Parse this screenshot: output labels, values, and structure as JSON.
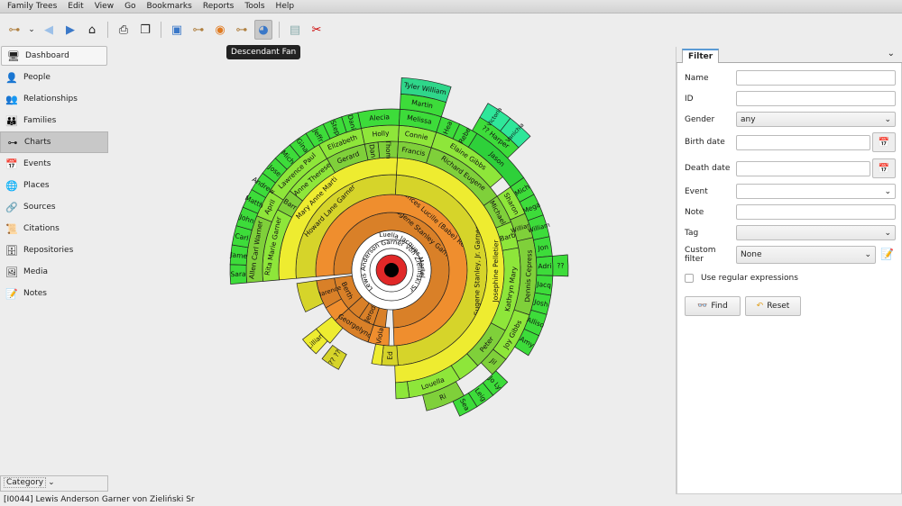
{
  "menu": [
    "Family Trees",
    "Edit",
    "View",
    "Go",
    "Bookmarks",
    "Reports",
    "Tools",
    "Help"
  ],
  "toolbar": {
    "tooltip": "Descendant Fan",
    "icons": [
      "tree-icon",
      "dropdown-icon",
      "back-icon",
      "forward-icon",
      "home-icon",
      "print-icon",
      "copy-icon",
      "config-icon",
      "pedigree-icon",
      "fan-icon",
      "descendant-tree-icon",
      "descendant-fan-icon",
      "media-icon",
      "scissors-icon"
    ]
  },
  "sidebar": {
    "items": [
      {
        "label": "Dashboard",
        "icon": "🖥"
      },
      {
        "label": "People",
        "icon": "👤"
      },
      {
        "label": "Relationships",
        "icon": "👥"
      },
      {
        "label": "Families",
        "icon": "👪"
      },
      {
        "label": "Charts",
        "icon": "⊶"
      },
      {
        "label": "Events",
        "icon": "📅"
      },
      {
        "label": "Places",
        "icon": "🌐"
      },
      {
        "label": "Sources",
        "icon": "🔗"
      },
      {
        "label": "Citations",
        "icon": "📜"
      },
      {
        "label": "Repositories",
        "icon": "🗄"
      },
      {
        "label": "Media",
        "icon": "🖼"
      },
      {
        "label": "Notes",
        "icon": "📝"
      }
    ],
    "selected": "Charts",
    "category": "Category"
  },
  "status": "[I0044] Lewis Anderson Garner von Zieliński Sr",
  "filter": {
    "tab": "Filter",
    "fields": {
      "name": {
        "label": "Name",
        "value": ""
      },
      "id": {
        "label": "ID",
        "value": ""
      },
      "gender": {
        "label": "Gender",
        "value": "any"
      },
      "birth": {
        "label": "Birth date",
        "value": ""
      },
      "death": {
        "label": "Death date",
        "value": ""
      },
      "event": {
        "label": "Event",
        "value": ""
      },
      "note": {
        "label": "Note",
        "value": ""
      },
      "tag": {
        "label": "Tag",
        "value": ""
      },
      "custom": {
        "label": "Custom filter",
        "value": "None"
      }
    },
    "regex": "Use regular expressions",
    "regex_checked": false,
    "find": "Find",
    "reset": "Reset"
  },
  "fan": {
    "center": {
      "person": "Lewis Anderson Garner von Zieliński Sr",
      "spouse": "Luella Jacques Martel",
      "color": "#e02828"
    },
    "segments": [
      {
        "label": "Eugene Stanley Garner",
        "ring": 0,
        "a": [
          -95,
          178
        ],
        "color": "#d98028"
      },
      {
        "label": "Frances Lucille (Babe) Reed",
        "ring": 1,
        "a": [
          -95,
          178
        ],
        "color": "#ef8e2e"
      },
      {
        "label": "Howard Lane Garner",
        "ring": 2,
        "a": [
          -95,
          3
        ],
        "color": "#d6d42a"
      },
      {
        "label": "Eugene Stanley, Jr. Garner",
        "ring": 2,
        "a": [
          3,
          178
        ],
        "color": "#d6d42a"
      },
      {
        "label": "Mary Anne Marti",
        "ring": 3,
        "a": [
          -95,
          3
        ],
        "color": "#eeec30"
      },
      {
        "label": "Josephine Pelletier",
        "ring": 3,
        "a": [
          3,
          178
        ],
        "color": "#eeec30"
      },
      {
        "label": "Rita Marie Garner",
        "ring": 4,
        "a": [
          -95,
          -62
        ],
        "color": "#8ee63a"
      },
      {
        "label": "Barr",
        "ring": 4,
        "a": [
          -62,
          -52
        ],
        "color": "#7fd03a"
      },
      {
        "label": "Anne Therese",
        "ring": 4,
        "a": [
          -52,
          -30
        ],
        "color": "#8ee63a"
      },
      {
        "label": "Gerard",
        "ring": 4,
        "a": [
          -30,
          -12
        ],
        "color": "#7fd03a"
      },
      {
        "label": "Dan",
        "ring": 4,
        "a": [
          -12,
          -6
        ],
        "color": "#7fd03a"
      },
      {
        "label": "Thom",
        "ring": 4,
        "a": [
          -6,
          3
        ],
        "color": "#7fd03a"
      },
      {
        "label": "Francis",
        "ring": 4,
        "a": [
          3,
          18
        ],
        "color": "#7fd03a"
      },
      {
        "label": "Richard Eugene",
        "ring": 4,
        "a": [
          18,
          55
        ],
        "color": "#7fd03a"
      },
      {
        "label": "Michael",
        "ring": 4,
        "a": [
          55,
          68
        ],
        "color": "#7fd03a"
      },
      {
        "label": "Barb",
        "ring": 4,
        "a": [
          68,
          80
        ],
        "color": "#8ee63a"
      },
      {
        "label": "Kathryn Mary",
        "ring": 4,
        "a": [
          80,
          118
        ],
        "color": "#8ee63a"
      },
      {
        "label": "Peter",
        "ring": 4,
        "a": [
          118,
          138
        ],
        "color": "#7fd03a"
      },
      {
        "label": "",
        "ring": 4,
        "a": [
          138,
          148
        ],
        "color": "#8ee63a"
      },
      {
        "label": "Louella",
        "ring": 4,
        "a": [
          148,
          172
        ],
        "color": "#8ee63a"
      },
      {
        "label": "",
        "ring": 4,
        "a": [
          172,
          178
        ],
        "color": "#8ee63a"
      },
      {
        "label": "Allen Carl Warner",
        "ring": 5,
        "a": [
          -95,
          -68
        ],
        "color": "#7fd03a"
      },
      {
        "label": "April",
        "ring": 5,
        "a": [
          -68,
          -57
        ],
        "color": "#8ee63a"
      },
      {
        "label": "Lawrence Paul",
        "ring": 5,
        "a": [
          -57,
          -30
        ],
        "color": "#8ee63a"
      },
      {
        "label": "Elizabeth",
        "ring": 5,
        "a": [
          -30,
          -12
        ],
        "color": "#8ee63a"
      },
      {
        "label": "Holly",
        "ring": 5,
        "a": [
          -12,
          3
        ],
        "color": "#8ee63a"
      },
      {
        "label": "Connie",
        "ring": 5,
        "a": [
          3,
          18
        ],
        "color": "#8ee63a"
      },
      {
        "label": "Elaine Gibbs",
        "ring": 5,
        "a": [
          18,
          50
        ],
        "color": "#8ee63a"
      },
      {
        "label": "Sharon",
        "ring": 5,
        "a": [
          55,
          67
        ],
        "color": "#8ee63a"
      },
      {
        "label": "William",
        "ring": 5,
        "a": [
          67,
          77
        ],
        "color": "#7fd03a"
      },
      {
        "label": "Dennis Cepress",
        "ring": 5,
        "a": [
          77,
          108
        ],
        "color": "#7fd03a"
      },
      {
        "label": "Joy Gibbs",
        "ring": 5,
        "a": [
          108,
          128
        ],
        "color": "#8ee63a"
      },
      {
        "label": "Jil",
        "ring": 5,
        "a": [
          128,
          136
        ],
        "color": "#7fd03a"
      },
      {
        "label": "Ri",
        "ring": 5,
        "a": [
          150,
          166
        ],
        "color": "#7fd03a"
      },
      {
        "label": "Sara",
        "ring": 6,
        "a": [
          -95,
          -88
        ],
        "color": "#3ddc3a"
      },
      {
        "label": "Jame",
        "ring": 6,
        "a": [
          -88,
          -81
        ],
        "color": "#3ddc3a"
      },
      {
        "label": "Carl",
        "ring": 6,
        "a": [
          -81,
          -74
        ],
        "color": "#3ddc3a"
      },
      {
        "label": "John",
        "ring": 6,
        "a": [
          -74,
          -67
        ],
        "color": "#3ddc3a"
      },
      {
        "label": "Matth",
        "ring": 6,
        "a": [
          -67,
          -60
        ],
        "color": "#3ddc3a"
      },
      {
        "label": "Andrew",
        "ring": 6,
        "a": [
          -60,
          -53
        ],
        "color": "#3ddc3a"
      },
      {
        "label": "Jose",
        "ring": 6,
        "a": [
          -53,
          -46
        ],
        "color": "#3ddc3a"
      },
      {
        "label": "Mich",
        "ring": 6,
        "a": [
          -46,
          -39
        ],
        "color": "#3ddc3a"
      },
      {
        "label": "Gina",
        "ring": 6,
        "a": [
          -39,
          -32
        ],
        "color": "#3ddc3a"
      },
      {
        "label": "Jeffr",
        "ring": 6,
        "a": [
          -32,
          -25
        ],
        "color": "#3ddc3a"
      },
      {
        "label": "Step",
        "ring": 6,
        "a": [
          -25,
          -18
        ],
        "color": "#3ddc3a"
      },
      {
        "label": "Dani",
        "ring": 6,
        "a": [
          -18,
          -12
        ],
        "color": "#3ddc3a"
      },
      {
        "label": "Alecia",
        "ring": 6,
        "a": [
          -12,
          3
        ],
        "color": "#3ddc3a"
      },
      {
        "label": "Melissa",
        "ring": 6,
        "a": [
          3,
          18
        ],
        "color": "#3ddc3a"
      },
      {
        "label": "Hea",
        "ring": 6,
        "a": [
          18,
          25
        ],
        "color": "#3ddc3a"
      },
      {
        "label": "Rebe",
        "ring": 6,
        "a": [
          25,
          32
        ],
        "color": "#3ddc3a"
      },
      {
        "label": "Jason",
        "ring": 6,
        "a": [
          32,
          55
        ],
        "color": "#2ed03a"
      },
      {
        "label": "Mich",
        "ring": 6,
        "a": [
          55,
          62
        ],
        "color": "#3ddc3a"
      },
      {
        "label": "Mega",
        "ring": 6,
        "a": [
          62,
          70
        ],
        "color": "#3ddc3a"
      },
      {
        "label": "William",
        "ring": 6,
        "a": [
          70,
          78
        ],
        "color": "#3ddc3a"
      },
      {
        "label": "Jon",
        "ring": 6,
        "a": [
          78,
          85
        ],
        "color": "#3ddc3a"
      },
      {
        "label": "Adri",
        "ring": 6,
        "a": [
          85,
          92
        ],
        "color": "#3ddc3a"
      },
      {
        "label": "Jacq",
        "ring": 6,
        "a": [
          92,
          99
        ],
        "color": "#3ddc3a"
      },
      {
        "label": "Josh",
        "ring": 6,
        "a": [
          99,
          106
        ],
        "color": "#3ddc3a"
      },
      {
        "label": "Alliso",
        "ring": 6,
        "a": [
          106,
          114
        ],
        "color": "#3ddc3a"
      },
      {
        "label": "Amy",
        "ring": 6,
        "a": [
          114,
          122
        ],
        "color": "#3ddc3a"
      },
      {
        "label": "Jo Ly",
        "ring": 6,
        "a": [
          134,
          141
        ],
        "color": "#3ddc3a"
      },
      {
        "label": "Leig",
        "ring": 6,
        "a": [
          141,
          148
        ],
        "color": "#3ddc3a"
      },
      {
        "label": "Sea",
        "ring": 6,
        "a": [
          148,
          155
        ],
        "color": "#3ddc3a"
      },
      {
        "label": "Martin",
        "ring": 7,
        "a": [
          3,
          18
        ],
        "color": "#3ddc3a"
      },
      {
        "label": "?? Harper",
        "ring": 7,
        "a": [
          30,
          46
        ],
        "color": "#3ddc3a"
      },
      {
        "label": "??",
        "ring": 7,
        "a": [
          85,
          92
        ],
        "color": "#3ddc3a"
      },
      {
        "label": "Tyler William",
        "ring": 8,
        "a": [
          3,
          18
        ],
        "color": "#2fd68a"
      },
      {
        "label": "Victoria",
        "ring": 8,
        "a": [
          30,
          38
        ],
        "color": "#2fe69a"
      },
      {
        "label": "Vanichia",
        "ring": 8,
        "a": [
          38,
          46
        ],
        "color": "#2fe69a"
      },
      {
        "label": "Berth",
        "ring": 0,
        "a": [
          228,
          262
        ],
        "color": "#d98028"
      },
      {
        "label": "",
        "ring": 0,
        "a": [
          214,
          228
        ],
        "color": "#d98028"
      },
      {
        "label": "Jerod",
        "ring": 0,
        "a": [
          198,
          214
        ],
        "color": "#d98028"
      },
      {
        "label": "",
        "ring": 0,
        "a": [
          186,
          198
        ],
        "color": "#d98028"
      },
      {
        "label": "Clarence",
        "ring": 1,
        "a": [
          240,
          262
        ],
        "color": "#d98028"
      },
      {
        "label": "",
        "ring": 1,
        "a": [
          228,
          240
        ],
        "color": "#ef8e2e"
      },
      {
        "label": "Georgelynd",
        "ring": 1,
        "a": [
          198,
          228
        ],
        "color": "#d98028"
      },
      {
        "label": "Viola",
        "ring": 1,
        "a": [
          182,
          198
        ],
        "color": "#ef8e2e"
      },
      {
        "label": "",
        "ring": 2,
        "a": [
          244,
          262
        ],
        "color": "#d6d42a"
      },
      {
        "label": "",
        "ring": 2,
        "a": [
          220,
          232
        ],
        "color": "#eeec30"
      },
      {
        "label": "Lillian",
        "ring": 3,
        "a": [
          222,
          232
        ],
        "color": "#eeec30"
      },
      {
        "label": "?? ??",
        "ring": 3,
        "a": [
          208,
          218
        ],
        "color": "#d6d42a"
      },
      {
        "label": "Ed",
        "ring": 2,
        "a": [
          176,
          186
        ],
        "color": "#d6d42a"
      },
      {
        "label": "",
        "ring": 2,
        "a": [
          186,
          192
        ],
        "color": "#eeec30"
      }
    ]
  }
}
